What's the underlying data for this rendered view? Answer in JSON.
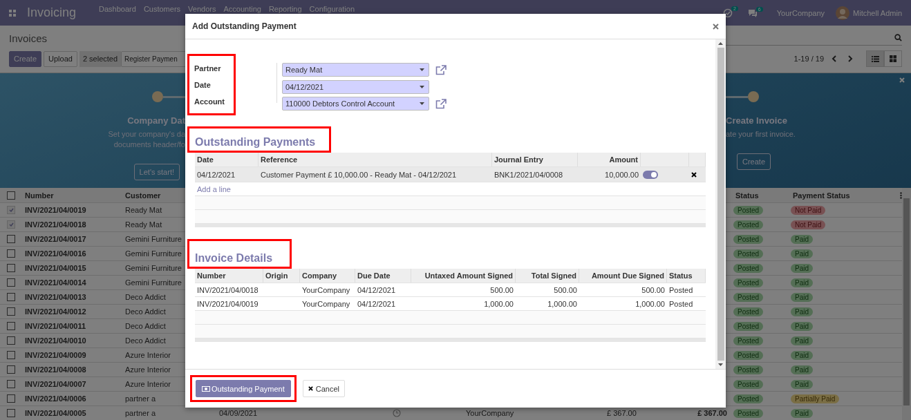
{
  "navbar": {
    "app_title": "Invoicing",
    "menu": [
      "Dashboard",
      "Customers",
      "Vendors",
      "Accounting",
      "Reporting",
      "Configuration"
    ],
    "activity_count": "2",
    "message_count": "6",
    "company": "YourCompany",
    "user": "Mitchell Admin"
  },
  "control_panel": {
    "title": "Invoices",
    "buttons": [
      {
        "label": "Create",
        "kind": "primary"
      },
      {
        "label": "Upload",
        "kind": "secondary"
      }
    ],
    "selection": "2 selected",
    "action_button": "Register Paymen",
    "pager": "1-19 / 19",
    "views": [
      {
        "kind": "list",
        "selected": true
      },
      {
        "kind": "kanban",
        "selected": false
      }
    ]
  },
  "banner": {
    "left_step": {
      "title": "Company Dat",
      "text_lines": [
        "Set your company's da",
        "documents header/fo"
      ],
      "button": "Let's start!"
    },
    "right_step": {
      "title": "Create Invoice",
      "text_lines": [
        "ate your first invoice."
      ],
      "button": "Create"
    }
  },
  "list": {
    "all_checked": false,
    "columns_left": [
      "Number",
      "Customer"
    ],
    "columns_right": [
      "Status",
      "Payment Status"
    ],
    "rows": [
      {
        "checked": true,
        "number": "INV/2021/04/0019",
        "customer": "Ready Mat",
        "status": "Posted",
        "payment": {
          "label": "Not Paid",
          "kind": "danger"
        }
      },
      {
        "checked": true,
        "number": "INV/2021/04/0018",
        "customer": "Ready Mat",
        "status": "Posted",
        "payment": {
          "label": "Not Paid",
          "kind": "danger"
        }
      },
      {
        "checked": false,
        "number": "INV/2021/04/0017",
        "customer": "Gemini Furniture",
        "status": "Posted",
        "payment": {
          "label": "Paid",
          "kind": "success"
        }
      },
      {
        "checked": false,
        "number": "INV/2021/04/0016",
        "customer": "Gemini Furniture",
        "status": "Posted",
        "payment": {
          "label": "Paid",
          "kind": "success"
        }
      },
      {
        "checked": false,
        "number": "INV/2021/04/0015",
        "customer": "Gemini Furniture",
        "status": "Posted",
        "payment": {
          "label": "Paid",
          "kind": "success"
        }
      },
      {
        "checked": false,
        "number": "INV/2021/04/0014",
        "customer": "Gemini Furniture",
        "status": "Posted",
        "payment": {
          "label": "Paid",
          "kind": "success"
        }
      },
      {
        "checked": false,
        "number": "INV/2021/04/0013",
        "customer": "Deco Addict",
        "status": "Posted",
        "payment": {
          "label": "Paid",
          "kind": "success"
        }
      },
      {
        "checked": false,
        "number": "INV/2021/04/0012",
        "customer": "Deco Addict",
        "status": "Posted",
        "payment": {
          "label": "Paid",
          "kind": "success"
        }
      },
      {
        "checked": false,
        "number": "INV/2021/04/0011",
        "customer": "Deco Addict",
        "status": "Posted",
        "payment": {
          "label": "Paid",
          "kind": "success"
        }
      },
      {
        "checked": false,
        "number": "INV/2021/04/0010",
        "customer": "Deco Addict",
        "status": "Posted",
        "payment": {
          "label": "Paid",
          "kind": "success"
        }
      },
      {
        "checked": false,
        "number": "INV/2021/04/0009",
        "customer": "Azure Interior",
        "status": "Posted",
        "payment": {
          "label": "Paid",
          "kind": "success"
        }
      },
      {
        "checked": false,
        "number": "INV/2021/04/0008",
        "customer": "Azure Interior",
        "status": "Posted",
        "payment": {
          "label": "Paid",
          "kind": "success"
        }
      },
      {
        "checked": false,
        "number": "INV/2021/04/0007",
        "customer": "Azure Interior",
        "status": "Posted",
        "payment": {
          "label": "Paid",
          "kind": "success"
        }
      },
      {
        "checked": false,
        "number": "INV/2021/04/0006",
        "customer": "partner a",
        "status": "Posted",
        "payment": {
          "label": "Partially Paid",
          "kind": "warning"
        }
      },
      {
        "checked": false,
        "number": "INV/2021/04/0005",
        "customer": "partner a",
        "status": "Posted",
        "payment": {
          "label": "Paid",
          "kind": "success"
        },
        "middle": {
          "date": "04/09/2021",
          "company": "YourCompany",
          "amount": "£ 367.00",
          "total": "£ 367.00"
        }
      }
    ]
  },
  "modal": {
    "title": "Add Outstanding Payment",
    "fields_highlighted": true,
    "fields": [
      {
        "label": "Partner",
        "value": "Ready Mat",
        "link": true
      },
      {
        "label": "Date",
        "value": "04/12/2021",
        "link": false
      },
      {
        "label": "Account",
        "value": "110000 Debtors Control Account",
        "link": true
      }
    ],
    "outstanding": {
      "title": "Outstanding Payments",
      "highlighted": true,
      "columns": [
        {
          "label": "Date",
          "kind": "text"
        },
        {
          "label": "Reference",
          "kind": "text"
        },
        {
          "label": "Journal Entry",
          "kind": "text"
        },
        {
          "label": "Amount",
          "kind": "number"
        }
      ],
      "rows": [
        {
          "date": "04/12/2021",
          "reference": "Customer Payment £ 10,000.00 - Ready Mat - 04/12/2021",
          "journal_entry": "BNK1/2021/04/0008",
          "amount": "10,000.00",
          "on": true
        }
      ],
      "add_line": "Add a line"
    },
    "invoices": {
      "title": "Invoice Details",
      "highlighted": true,
      "columns": [
        {
          "label": "Number",
          "kind": "text"
        },
        {
          "label": "Origin",
          "kind": "text"
        },
        {
          "label": "Company",
          "kind": "text"
        },
        {
          "label": "Due Date",
          "kind": "text"
        },
        {
          "label": "Untaxed Amount Signed",
          "kind": "number"
        },
        {
          "label": "Total Signed",
          "kind": "number"
        },
        {
          "label": "Amount Due Signed",
          "kind": "number"
        },
        {
          "label": "Status",
          "kind": "text"
        }
      ],
      "rows": [
        {
          "cells": [
            "INV/2021/04/0018",
            "",
            "YourCompany",
            "04/12/2021",
            "500.00",
            "500.00",
            "500.00",
            "Posted"
          ]
        },
        {
          "cells": [
            "INV/2021/04/0019",
            "",
            "YourCompany",
            "04/12/2021",
            "1,000.00",
            "1,000.00",
            "1,000.00",
            "Posted"
          ]
        }
      ]
    },
    "buttons": [
      {
        "label": "Outstanding Payment",
        "kind": "primary",
        "highlighted": true
      },
      {
        "label": "Cancel",
        "kind": "secondary",
        "highlighted": false
      }
    ]
  }
}
